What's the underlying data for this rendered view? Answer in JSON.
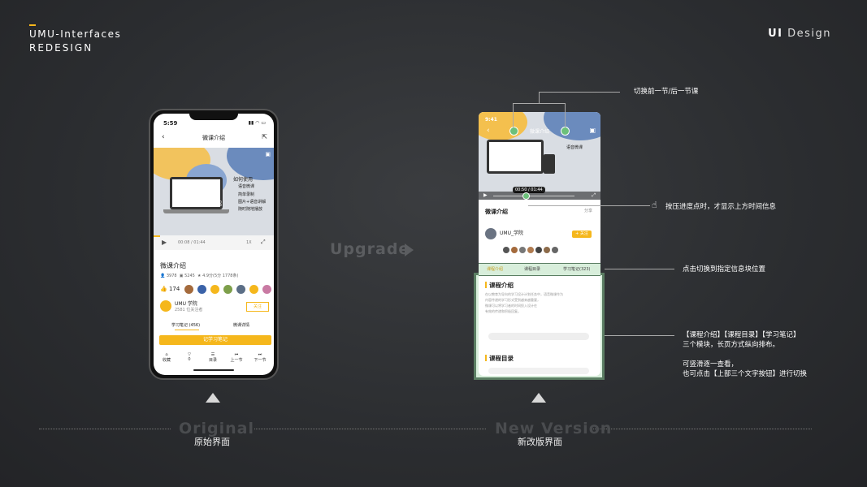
{
  "brand": {
    "line1": "UMU-Interfaces",
    "line2": "REDESIGN",
    "right_bold": "UI",
    "right_light": " Design",
    "accent": "#f5b71c"
  },
  "upgrade_label": "Upgrade",
  "original": {
    "ghost": "Original",
    "caption": "原始界面"
  },
  "new_version": {
    "ghost": "New Version",
    "caption": "新改版界面"
  },
  "annotations": {
    "switch_lesson": "切换前一节/后一节课",
    "press_progress": "按压进度点时，才显示上方时间信息",
    "tab_jump": "点击切换到指定信息块位置",
    "modules_1": "【课程介绍】【课程目录】【学习笔记】",
    "modules_2": "三个模块，长页方式纵向排布。",
    "scroll_1": "可竖滑逐一查看，",
    "scroll_2": "也可点击【上部三个文字按钮】进行切换"
  },
  "old_phone": {
    "time": "5:59",
    "nav_title": "微课介绍",
    "video_caption": "微课介绍",
    "video_heading": "如何使用",
    "video_sub": "语音微课",
    "video_bullets": [
      "简单录制",
      "图片+语音讲解",
      "随时随地播放"
    ],
    "progress_time": "00:08 / 01:44",
    "speed": "1X",
    "course_title": "微课介绍",
    "stats": [
      "3978",
      "5245",
      "4.9分(5分 1778条)"
    ],
    "likes": "174",
    "author": "UMU 学院",
    "followers": "2581 位关注者",
    "follow": "关注",
    "tabs": [
      "学习笔记 (456)",
      "微课详情"
    ],
    "note_button": "记学习笔记",
    "tabbar": [
      "收藏",
      "0",
      "目录",
      "上一节",
      "下一节"
    ]
  },
  "new_phone": {
    "time": "9:41",
    "nav_title": "微课介绍",
    "video_sub": "语音微课",
    "progress_time": "00:50 / 01:44",
    "course_title": "微课介绍",
    "share": "分享",
    "author": "UMU_学院",
    "follow": "+ 关注",
    "tabs": [
      "课程介绍",
      "课程目录",
      "学习笔记(323)"
    ],
    "section_intro": "课程介绍",
    "intro_text": [
      "在以教育为导向的学习设计计划任务中，语音微课作为",
      "内容传递的学习形式受到越来越重要，",
      "微课可以将学习者的时间投入设计在",
      "有效的传递和积极回复。"
    ],
    "section_toc": "课程目录"
  }
}
